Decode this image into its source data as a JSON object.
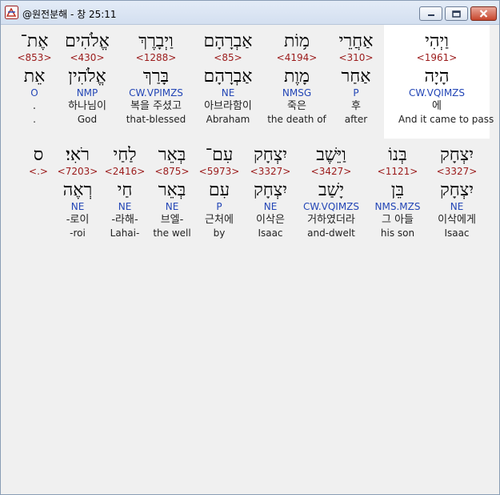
{
  "window": {
    "title": "@원전분해 - 창 25:11",
    "colors": {
      "strongs": "#9b1b1b",
      "morph": "#2346b6",
      "highlight": "#ffffff"
    }
  },
  "rows": [
    [
      {
        "surface": "וַיְהִי",
        "strongs": "<1961>",
        "lemma": "הָיָה",
        "morph": "CW.VQIMZS",
        "korean": "에",
        "english": "And it came to pass"
      },
      {
        "surface": "אַחֲרֵי",
        "strongs": "<310>",
        "lemma": "אַחַר",
        "morph": "P",
        "korean": "후",
        "english": "after"
      },
      {
        "surface": "מ֥וֹת",
        "strongs": "<4194>",
        "lemma": "מָוֶת",
        "morph": "NMSG",
        "korean": "죽은",
        "english": "the death of"
      },
      {
        "surface": "אַבְרָהָם",
        "strongs": "<85>",
        "lemma": "אַבְרָהָם",
        "morph": "NE",
        "korean": "아브라함이",
        "english": "Abraham"
      },
      {
        "surface": "וַיְבָרֶךְ",
        "strongs": "<1288>",
        "lemma": "בָּרַךְ",
        "morph": "CW.VPIMZS",
        "korean": "복을 주셨고",
        "english": "that-blessed"
      },
      {
        "surface": "אֱלֹהִים",
        "strongs": "<430>",
        "lemma": "אֱלֹהִין",
        "morph": "NMP",
        "korean": "하나님이",
        "english": "God"
      },
      {
        "surface": "אֶת־",
        "strongs": "<853>",
        "lemma": "אֵת",
        "morph": "O",
        "korean": ".",
        "english": "."
      }
    ],
    [
      {
        "surface": "יִצְחָק",
        "strongs": "<3327>",
        "lemma": "יִצְחָק",
        "morph": "NE",
        "korean": "이삭에게",
        "english": "Isaac"
      },
      {
        "surface": "בְּנוֹ",
        "strongs": "<1121>",
        "lemma": "בֵּן",
        "morph": "NMS.MZS",
        "korean": "그 아들",
        "english": "his son"
      },
      {
        "surface": "וַיֵּשֶׁב",
        "strongs": "<3427>",
        "lemma": "יָשַׁב",
        "morph": "CW.VQIMZS",
        "korean": "거하였더라",
        "english": "and-dwelt"
      },
      {
        "surface": "יִצְחָק",
        "strongs": "<3327>",
        "lemma": "יִצְחָק",
        "morph": "NE",
        "korean": "이삭은",
        "english": "Isaac"
      },
      {
        "surface": "עִם־",
        "strongs": "<5973>",
        "lemma": "עִם",
        "morph": "P",
        "korean": "근처에",
        "english": "by"
      },
      {
        "surface": "בְּאֵר",
        "strongs": "<875>",
        "lemma": "בְּאֵר",
        "morph": "NE",
        "korean": "브엘-",
        "english": "the well"
      },
      {
        "surface": "לַחַי",
        "strongs": "<2416>",
        "lemma": "חַי",
        "morph": "NE",
        "korean": "-라해-",
        "english": "Lahai-"
      },
      {
        "surface": "רֹאִי׃",
        "strongs": "<7203>",
        "lemma": "רְאֶה",
        "morph": "NE",
        "korean": "-로이",
        "english": "-roi"
      },
      {
        "surface": "ס",
        "strongs": "<.>"
      }
    ]
  ]
}
